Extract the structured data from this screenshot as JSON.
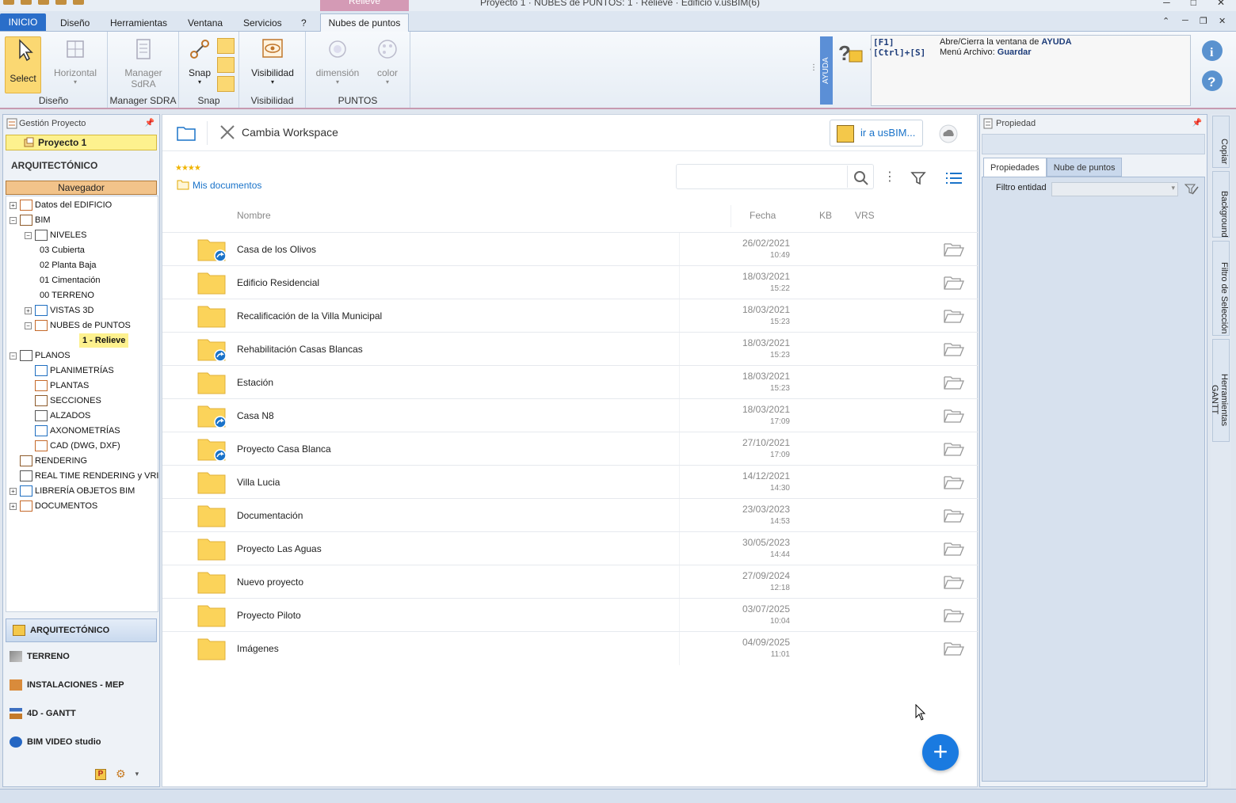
{
  "window": {
    "title": "Proyecto 1 · NUBES de PUNTOS: 1 · Relieve · Edificio v.usBIM(6)",
    "context_tab": "Relieve",
    "controls": [
      "─",
      "□",
      "✕"
    ]
  },
  "ribbon_tabs": [
    {
      "label": "INICIO"
    },
    {
      "label": "Diseño"
    },
    {
      "label": "Herramientas"
    },
    {
      "label": "Ventana"
    },
    {
      "label": "Servicios"
    },
    {
      "label": "?"
    },
    {
      "label": "Nubes de puntos"
    }
  ],
  "ribbon": {
    "groups": {
      "diseno": {
        "label": "Diseño",
        "select": "Select",
        "horizontal": "Horizontal"
      },
      "manager": {
        "label": "Manager SDRA",
        "btn1": "Manager",
        "btn2": "SdRA"
      },
      "snap": {
        "label": "Snap",
        "btn": "Snap"
      },
      "visibilidad": {
        "label": "Visibilidad",
        "btn": "Visibilidad"
      },
      "puntos": {
        "label": "PUNTOS",
        "btn1": "dimensión",
        "btn2": "color"
      }
    },
    "ayuda_label": "AYUDA",
    "help": [
      {
        "key": "[F1]",
        "desc": "Abre/Cierra la ventana de ",
        "bold": "AYUDA"
      },
      {
        "key": "[Ctrl]+[S]",
        "desc": "Menú Archivo: ",
        "bold": "Guardar"
      }
    ]
  },
  "left_panel": {
    "header": "Gestión Proyecto",
    "project": "Proyecto 1",
    "section": "ARQUITECTÓNICO",
    "navigator": "Navegador",
    "tree": [
      {
        "label": "Datos del EDIFICIO",
        "level": 0,
        "exp": "+"
      },
      {
        "label": "BIM",
        "level": 0,
        "exp": "−"
      },
      {
        "label": "NIVELES",
        "level": 1,
        "exp": "−"
      },
      {
        "label": "03 Cubierta",
        "level": 2,
        "exp": ""
      },
      {
        "label": "02 Planta Baja",
        "level": 2,
        "exp": ""
      },
      {
        "label": "01 Cimentación",
        "level": 2,
        "exp": ""
      },
      {
        "label": "00 TERRENO",
        "level": 2,
        "exp": ""
      },
      {
        "label": "VISTAS 3D",
        "level": 1,
        "exp": "+"
      },
      {
        "label": "NUBES de PUNTOS",
        "level": 1,
        "exp": "−"
      },
      {
        "label": "1 - Relieve",
        "level": 2,
        "exp": "",
        "selected": true
      },
      {
        "label": "PLANOS",
        "level": 0,
        "exp": "−"
      },
      {
        "label": "PLANIMETRÍAS",
        "level": 1,
        "exp": ""
      },
      {
        "label": "PLANTAS",
        "level": 1,
        "exp": ""
      },
      {
        "label": "SECCIONES",
        "level": 1,
        "exp": ""
      },
      {
        "label": "ALZADOS",
        "level": 1,
        "exp": ""
      },
      {
        "label": "AXONOMETRÍAS",
        "level": 1,
        "exp": ""
      },
      {
        "label": "CAD (DWG, DXF)",
        "level": 1,
        "exp": ""
      },
      {
        "label": "RENDERING",
        "level": 0,
        "exp": ""
      },
      {
        "label": "REAL TIME RENDERING y VRI",
        "level": 0,
        "exp": ""
      },
      {
        "label": "LIBRERÍA OBJETOS BIM",
        "level": 0,
        "exp": "+"
      },
      {
        "label": "DOCUMENTOS",
        "level": 0,
        "exp": "+"
      }
    ],
    "modules": [
      {
        "label": "ARQUITECTÓNICO",
        "active": true
      },
      {
        "label": "TERRENO"
      },
      {
        "label": "INSTALACIONES - MEP"
      },
      {
        "label": "4D - GANTT"
      },
      {
        "label": "BIM VIDEO studio"
      }
    ]
  },
  "center": {
    "workspace_label": "Cambia Workspace",
    "usbim_btn": "ir a usBIM...",
    "rating": "★★★★",
    "breadcrumb": "Mis documentos",
    "search_placeholder": "",
    "columns": {
      "name": "Nombre",
      "date": "Fecha",
      "kb": "KB",
      "vrs": "VRS"
    },
    "rows": [
      {
        "name": "Casa de los Olivos",
        "date": "26/02/2021",
        "time": "10:49",
        "shared": true
      },
      {
        "name": "Edificio Residencial",
        "date": "18/03/2021",
        "time": "15:22",
        "shared": false
      },
      {
        "name": "Recalificación de la Villa Municipal",
        "date": "18/03/2021",
        "time": "15:23",
        "shared": false
      },
      {
        "name": "Rehabilitación Casas Blancas",
        "date": "18/03/2021",
        "time": "15:23",
        "shared": true
      },
      {
        "name": "Estación",
        "date": "18/03/2021",
        "time": "15:23",
        "shared": false
      },
      {
        "name": "Casa N8",
        "date": "18/03/2021",
        "time": "17:09",
        "shared": true
      },
      {
        "name": "Proyecto Casa Blanca",
        "date": "27/10/2021",
        "time": "17:09",
        "shared": true
      },
      {
        "name": "Villa Lucia",
        "date": "14/12/2021",
        "time": "14:30",
        "shared": false
      },
      {
        "name": "Documentación",
        "date": "23/03/2023",
        "time": "14:53",
        "shared": false
      },
      {
        "name": "Proyecto Las Aguas",
        "date": "30/05/2023",
        "time": "14:44",
        "shared": false
      },
      {
        "name": "Nuevo proyecto",
        "date": "27/09/2024",
        "time": "12:18",
        "shared": false
      },
      {
        "name": "Proyecto Piloto",
        "date": "03/07/2025",
        "time": "10:04",
        "shared": false
      },
      {
        "name": "Imágenes",
        "date": "04/09/2025",
        "time": "11:01",
        "shared": false
      }
    ],
    "fab": "+"
  },
  "right_panel": {
    "header": "Propiedad",
    "tabs": [
      "Propiedades",
      "Nube de puntos"
    ],
    "filter_label": "Filtro entidad"
  },
  "side_tabs": [
    "Copiar",
    "Background",
    "Filtro de Selección",
    "Herramientas GANTT"
  ],
  "colors": {
    "accent": "#1a73c9",
    "folder": "#fbd35a",
    "selected": "#fdf18e",
    "inicio": "#2a6ec9"
  }
}
